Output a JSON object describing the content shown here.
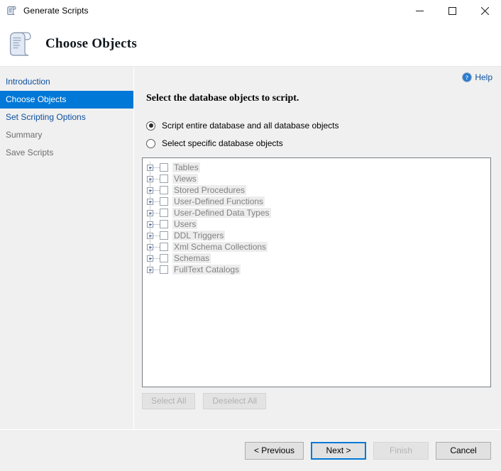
{
  "window": {
    "title": "Generate Scripts",
    "icon": "script-scroll-icon",
    "controls": {
      "minimize": "minimize-icon",
      "maximize": "maximize-icon",
      "close": "close-icon"
    }
  },
  "header": {
    "title": "Choose Objects",
    "icon": "script-scroll-icon"
  },
  "sidebar": {
    "items": [
      {
        "label": "Introduction",
        "state": "link"
      },
      {
        "label": "Choose Objects",
        "state": "selected"
      },
      {
        "label": "Set Scripting Options",
        "state": "link"
      },
      {
        "label": "Summary",
        "state": "disabled"
      },
      {
        "label": "Save Scripts",
        "state": "disabled"
      }
    ]
  },
  "content": {
    "help": {
      "label": "Help",
      "icon": "help-circle-icon"
    },
    "prompt": "Select the database objects to script.",
    "radios": [
      {
        "label": "Script entire database and all database objects",
        "checked": true
      },
      {
        "label": "Select specific database objects",
        "checked": false
      }
    ],
    "tree": [
      {
        "label": "Tables"
      },
      {
        "label": "Views"
      },
      {
        "label": "Stored Procedures"
      },
      {
        "label": "User-Defined Functions"
      },
      {
        "label": "User-Defined Data Types"
      },
      {
        "label": "Users"
      },
      {
        "label": "DDL Triggers"
      },
      {
        "label": "Xml Schema Collections"
      },
      {
        "label": "Schemas"
      },
      {
        "label": "FullText Catalogs"
      }
    ],
    "selection_buttons": [
      {
        "label": "Select All",
        "enabled": false
      },
      {
        "label": "Deselect All",
        "enabled": false
      }
    ]
  },
  "footer": {
    "buttons": [
      {
        "label": "< Previous",
        "enabled": true,
        "focused": false
      },
      {
        "label": "Next >",
        "enabled": true,
        "focused": true
      },
      {
        "label": "Finish",
        "enabled": false,
        "focused": false
      },
      {
        "label": "Cancel",
        "enabled": true,
        "focused": false
      }
    ]
  },
  "colors": {
    "accent": "#0078d7",
    "link": "#0b4f9e",
    "panel": "#f0f0f0",
    "disabled_text": "#b0b0b0"
  }
}
